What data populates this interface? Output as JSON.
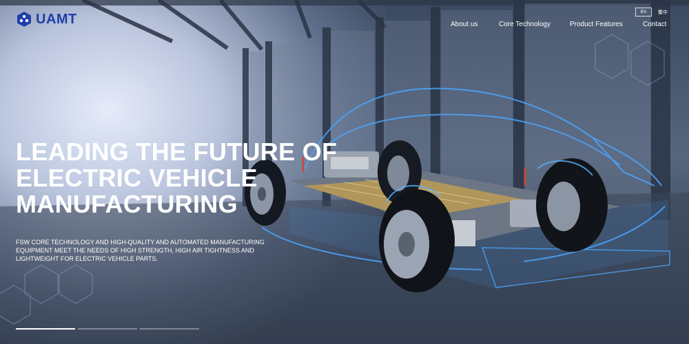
{
  "brand": {
    "name": "UAMT",
    "logo_icon": "hexagon-cluster-icon",
    "color": "#1f3fa8"
  },
  "nav": {
    "items": [
      "About us",
      "Core Technology",
      "Product Features",
      "Contact"
    ]
  },
  "language": {
    "en": "En",
    "tc": "繁中"
  },
  "hero": {
    "headline": [
      "LEADING THE FUTURE OF",
      "ELECTRIC VEHICLE",
      "MANUFACTURING"
    ],
    "subtext": "FSW CORE TECHNOLOGY AND HIGH-QUALITY AND AUTOMATED MANUFACTURING EQUIPMENT MEET THE NEEDS OF HIGH STRENGTH, HIGH AIR TIGHTNESS AND LIGHTWEIGHT FOR ELECTRIC VEHICLE PARTS."
  },
  "slider": {
    "count": 3,
    "active": 1
  },
  "colors": {
    "accent_glow": "#3aa0ff",
    "headline": "#ffffff"
  }
}
